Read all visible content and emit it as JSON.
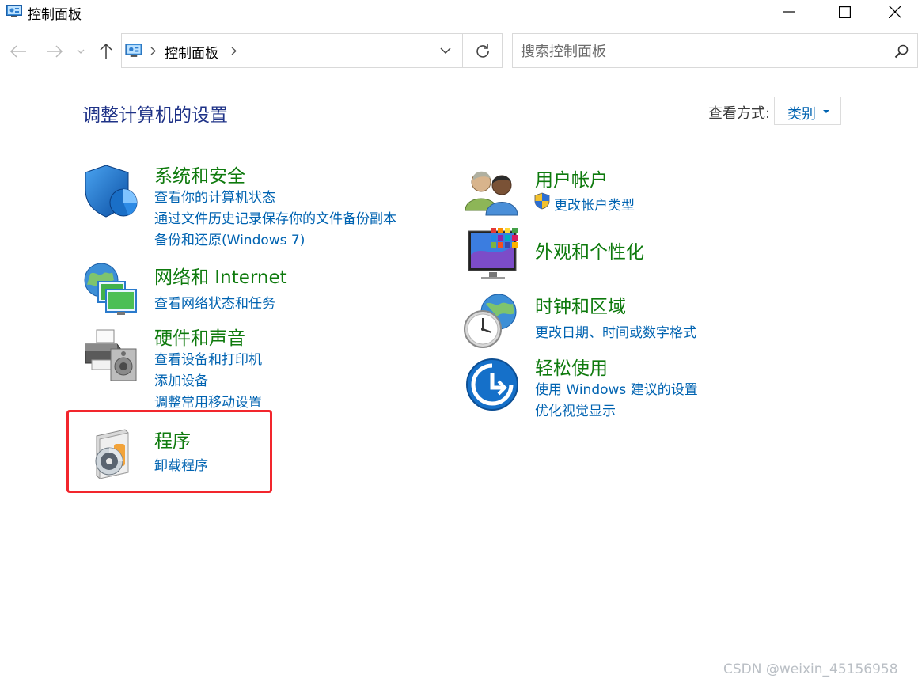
{
  "window": {
    "title": "控制面板"
  },
  "address_bar": {
    "breadcrumb": [
      "控制面板"
    ]
  },
  "search": {
    "placeholder": "搜索控制面板"
  },
  "main": {
    "heading": "调整计算机的设置",
    "view_by_label": "查看方式:",
    "view_by_value": "类别"
  },
  "categories": [
    {
      "title": "系统和安全",
      "icon": "shield-pie-icon",
      "links": [
        "查看你的计算机状态",
        "通过文件历史记录保存你的文件备份副本",
        "备份和还原(Windows 7)"
      ]
    },
    {
      "title": "网络和 Internet",
      "icon": "network-globe-icon",
      "links": [
        "查看网络状态和任务"
      ]
    },
    {
      "title": "硬件和声音",
      "icon": "printer-speaker-icon",
      "links": [
        "查看设备和打印机",
        "添加设备",
        "调整常用移动设置"
      ]
    },
    {
      "title": "程序",
      "icon": "program-disc-icon",
      "links": [
        "卸载程序"
      ]
    },
    {
      "title": "用户帐户",
      "icon": "users-icon",
      "links": [
        "更改帐户类型"
      ]
    },
    {
      "title": "外观和个性化",
      "icon": "monitor-colors-icon",
      "links": []
    },
    {
      "title": "时钟和区域",
      "icon": "clock-globe-icon",
      "links": [
        "更改日期、时间或数字格式"
      ]
    },
    {
      "title": "轻松使用",
      "icon": "ease-of-access-icon",
      "links": [
        "使用 Windows 建议的设置",
        "优化视觉显示"
      ]
    }
  ],
  "watermark": "CSDN @weixin_45156958",
  "colors": {
    "category_title": "#0e7a0d",
    "link": "#0063b1",
    "heading": "#1e3287",
    "highlight_border": "#f2262d"
  }
}
